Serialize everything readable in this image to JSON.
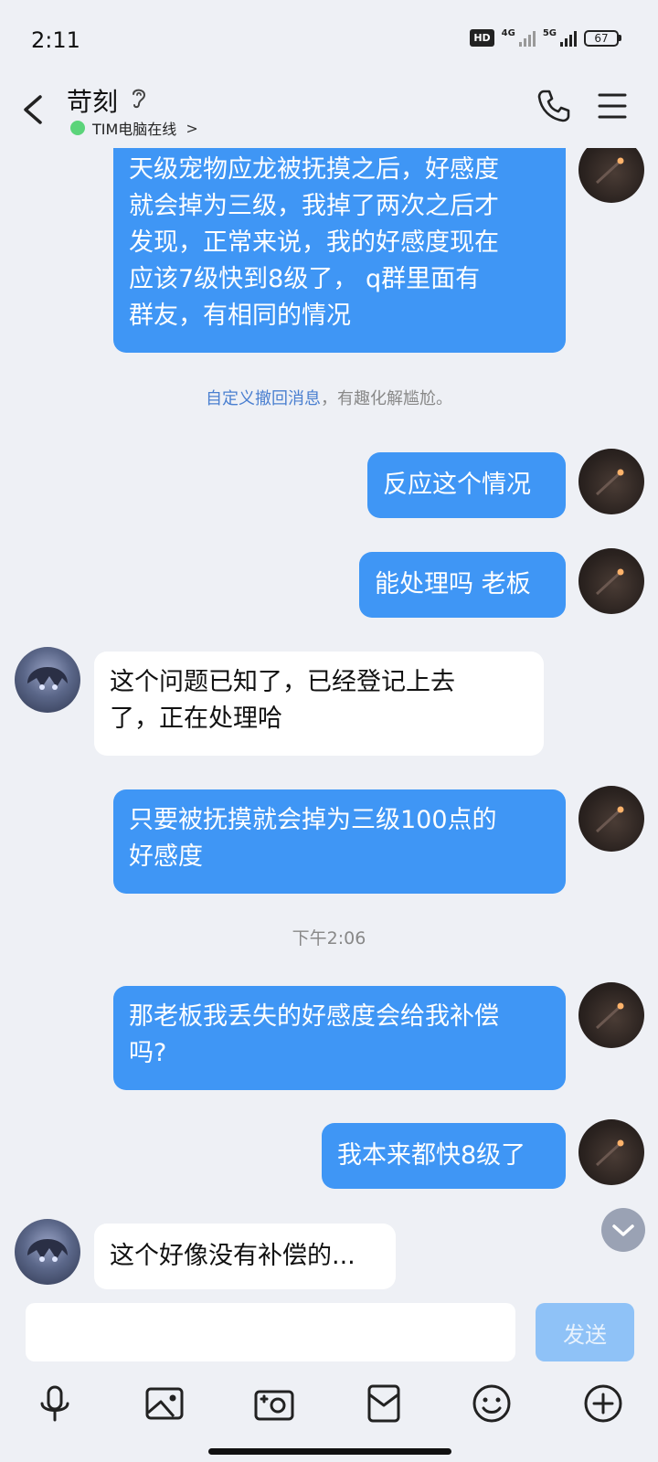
{
  "status_bar": {
    "time": "2:11",
    "hd_badge": "HD",
    "network_1": "4G",
    "network_2": "5G",
    "battery": "67"
  },
  "header": {
    "contact_name": "苛刻",
    "online_status": "TIM电脑在线",
    "online_chevron": ">",
    "icons": [
      "back-arrow-icon",
      "ear-icon",
      "phone-icon",
      "menu-icon"
    ]
  },
  "messages": [
    {
      "side": "out",
      "lines": [
        "天级宠物应龙被抚摸之后，好感度",
        "就会掉为三级，我掉了两次之后才",
        "发现，正常来说，我的好感度现在",
        "应该7级快到8级了， q群里面有",
        "群友，有相同的情况"
      ]
    },
    {
      "side": "out",
      "lines": [
        "反应这个情况"
      ]
    },
    {
      "side": "out",
      "lines": [
        "能处理吗 老板"
      ]
    },
    {
      "side": "in",
      "lines": [
        "这个问题已知了，已经登记上去",
        "了，正在处理哈"
      ]
    },
    {
      "side": "out",
      "lines": [
        "只要被抚摸就会掉为三级100点的",
        "好感度"
      ]
    },
    {
      "side": "out",
      "lines": [
        "那老板我丢失的好感度会给我补偿",
        "吗?"
      ]
    },
    {
      "side": "out",
      "lines": [
        "我本来都快8级了"
      ]
    },
    {
      "side": "in",
      "lines": [
        "这个好像没有补偿的..."
      ]
    }
  ],
  "notice": {
    "link_text": "自定义撤回消息",
    "rest_text": "，有趣化解尴尬。"
  },
  "timestamp": "下午2:06",
  "input": {
    "placeholder": "",
    "send_label": "发送"
  },
  "toolbar": [
    "microphone-icon",
    "image-icon",
    "camera-icon",
    "red-packet-icon",
    "emoji-icon",
    "plus-icon"
  ],
  "colors": {
    "outgoing_bubble": "#3f96f5",
    "incoming_bubble": "#ffffff",
    "background": "#eef0f5",
    "send_button": "#8fc2f7",
    "online_dot": "#5bd47a",
    "notice_link": "#4a7fd0"
  }
}
